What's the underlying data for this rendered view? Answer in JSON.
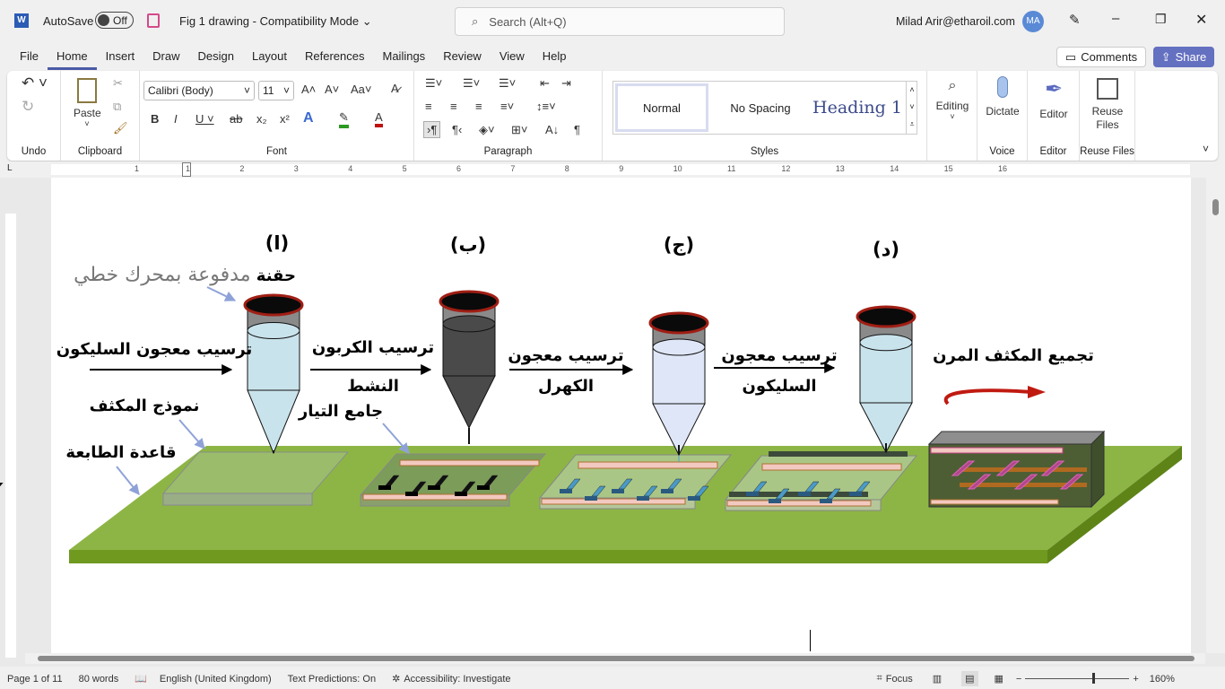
{
  "titlebar": {
    "autosave_label": "AutoSave",
    "autosave_state": "Off",
    "doc_title": "Fig 1 drawing  -  Compatibility Mode",
    "search_placeholder": "Search (Alt+Q)",
    "user": "Milad Arir@etharoil.com",
    "avatar_initials": "MA"
  },
  "tabs": [
    "File",
    "Home",
    "Insert",
    "Draw",
    "Design",
    "Layout",
    "References",
    "Mailings",
    "Review",
    "View",
    "Help"
  ],
  "actions": {
    "comments": "Comments",
    "share": "Share"
  },
  "ribbon": {
    "undo_group": "Undo",
    "clipboard_group": "Clipboard",
    "paste": "Paste",
    "font_group": "Font",
    "font_name": "Calibri (Body)",
    "font_size": "11",
    "paragraph_group": "Paragraph",
    "styles_group": "Styles",
    "styles": [
      "Normal",
      "No Spacing",
      "Heading 1"
    ],
    "editing": "Editing",
    "dictate": "Dictate",
    "voice_group": "Voice",
    "editor": "Editor",
    "editor_group": "Editor",
    "reuse": "Reuse Files",
    "reuse_group": "Reuse Files"
  },
  "ruler_numbers": [
    "1",
    "1",
    "2",
    "3",
    "4",
    "5",
    "6",
    "7",
    "8",
    "9",
    "10",
    "11",
    "12",
    "13",
    "14",
    "15",
    "16"
  ],
  "figure": {
    "labels": {
      "a": "(ا)",
      "b": "(ب)",
      "c": "(ج)",
      "d": "(د)"
    },
    "syringe_bold": "حقنة",
    "syringe_rest": "مدفوعة بمحرك خطي",
    "step1": "ترسيب معجون السليكون",
    "step2_line1": "ترسيب الكربون",
    "step2_line2": "النشط",
    "step3_line1": "ترسيب معجون",
    "step3_line2": "الكهرل",
    "step4_line1": "ترسيب معجون",
    "step4_line2": "السليكون",
    "step5": "تجميع المكثف المرن",
    "capacitor_model": "نموذج المكثف",
    "printer_base": "قاعدة الطابعة",
    "current_collector": "جامع التيار",
    "colors": {
      "base": "#8db545",
      "syringe_rim": "#a01e14",
      "electrolyte": "#dfe6f7",
      "silicone": "#c9e3ec",
      "collector": "#f2c9c0",
      "electrode": "#4a9ac8"
    }
  },
  "status": {
    "page": "Page 1 of 11",
    "words": "80 words",
    "language": "English (United Kingdom)",
    "predictions": "Text Predictions: On",
    "accessibility": "Accessibility: Investigate",
    "focus": "Focus",
    "zoom": "160%",
    "zoom_percent": 160
  }
}
